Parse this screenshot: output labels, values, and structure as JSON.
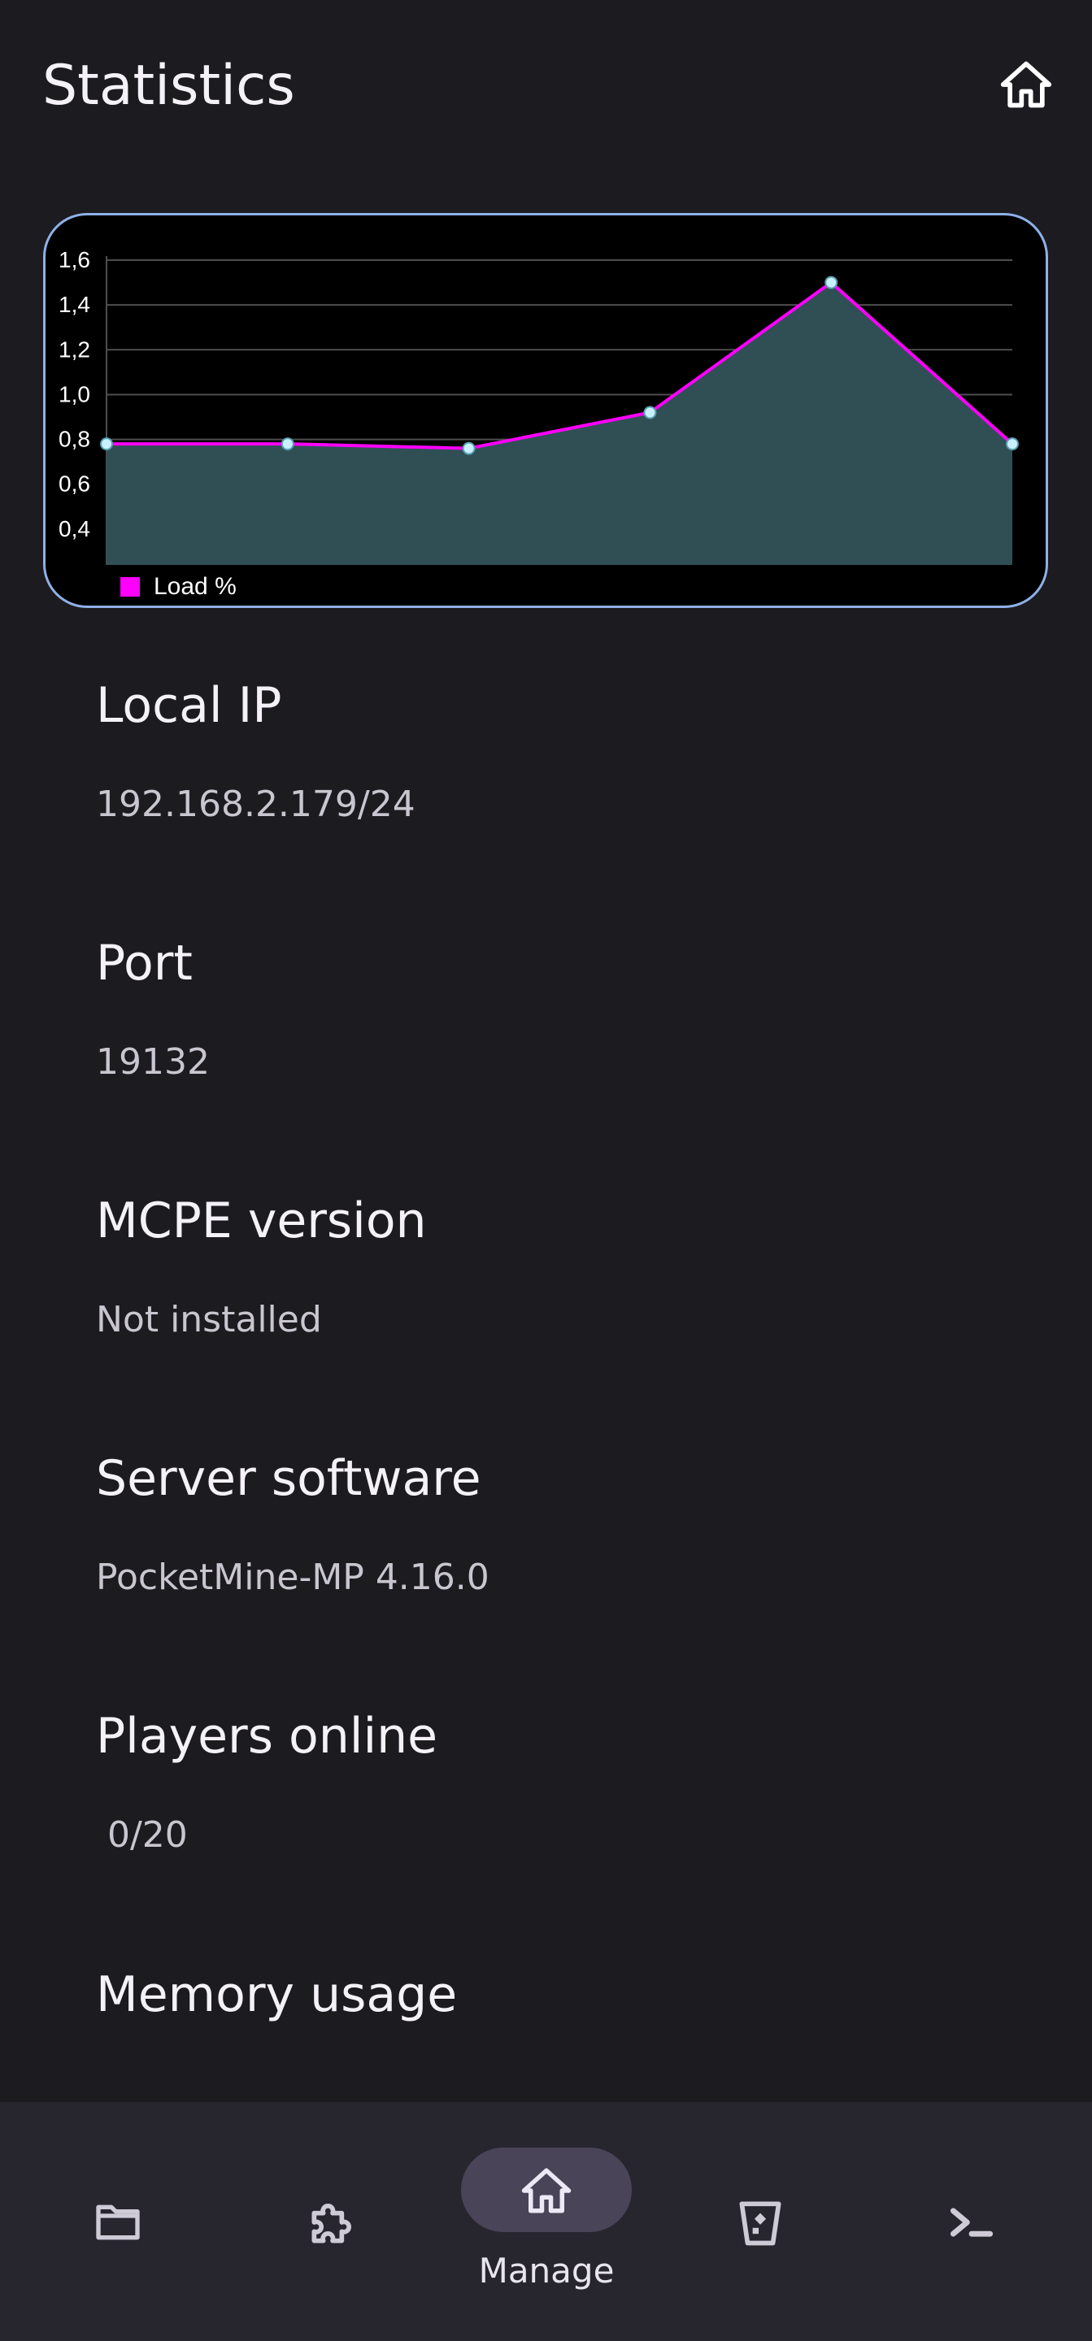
{
  "header": {
    "title": "Statistics",
    "home_icon": "home-icon"
  },
  "chart_data": {
    "type": "area",
    "x": [
      1,
      2,
      3,
      4,
      5,
      6
    ],
    "series": [
      {
        "name": "Load %",
        "values": [
          0.78,
          0.78,
          0.76,
          0.92,
          1.5,
          0.78
        ],
        "line_color": "#ff00ff",
        "fill_color": "#2f4f55",
        "point_color": "#c8f0ff"
      }
    ],
    "yticks": [
      "1,6",
      "1,4",
      "1,2",
      "1,0",
      "0,8",
      "0,6",
      "0,4"
    ],
    "ylim": [
      0.24,
      1.6
    ],
    "grid": true,
    "legend": "bottom-left"
  },
  "stats": [
    {
      "label": "Local IP",
      "value": "192.168.2.179/24"
    },
    {
      "label": "Port",
      "value": "19132"
    },
    {
      "label": "MCPE version",
      "value": "Not installed"
    },
    {
      "label": "Server software",
      "value": "PocketMine-MP 4.16.0"
    },
    {
      "label": "Players online",
      "value": " 0/20"
    },
    {
      "label": "Memory usage",
      "value": ""
    }
  ],
  "bottom_nav": {
    "items": [
      {
        "icon": "folder-icon"
      },
      {
        "icon": "puzzle-icon"
      },
      {
        "icon": "home-icon",
        "label": "Manage",
        "active": true
      },
      {
        "icon": "bucket-icon"
      },
      {
        "icon": "terminal-icon"
      }
    ],
    "colors": {
      "background": "#27262f",
      "active_pill": "#4a4458",
      "icon": "#cfcbd6"
    }
  }
}
